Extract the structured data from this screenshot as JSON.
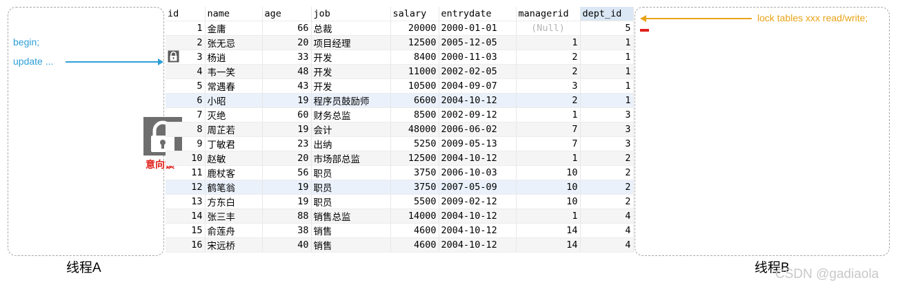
{
  "thread_a": {
    "label": "线程A",
    "begin": "begin;",
    "update": "update ..."
  },
  "thread_b": {
    "label": "线程B",
    "lock_statement": "lock tables xxx read/write;"
  },
  "intention_lock_label": "意向锁",
  "watermark": "CSDN @gadiaola",
  "icons": [
    "lock-icon",
    "row-lock-icon"
  ],
  "colors": {
    "blue_note": "#2e9fd8",
    "orange_note": "#e8a317",
    "red_label": "#e0201b"
  },
  "table": {
    "columns": [
      "id",
      "name",
      "age",
      "job",
      "salary",
      "entrydate",
      "managerid",
      "dept_id"
    ],
    "rows": [
      [
        "1",
        "金庸",
        "66",
        "总裁",
        "20000",
        "2000-01-01",
        "(Null)",
        "5"
      ],
      [
        "2",
        "张无忌",
        "20",
        "项目经理",
        "12500",
        "2005-12-05",
        "1",
        "1"
      ],
      [
        "3",
        "杨逍",
        "33",
        "开发",
        "8400",
        "2000-11-03",
        "2",
        "1"
      ],
      [
        "4",
        "韦一笑",
        "48",
        "开发",
        "11000",
        "2002-02-05",
        "2",
        "1"
      ],
      [
        "5",
        "常遇春",
        "43",
        "开发",
        "10500",
        "2004-09-07",
        "3",
        "1"
      ],
      [
        "6",
        "小昭",
        "19",
        "程序员鼓励师",
        "6600",
        "2004-10-12",
        "2",
        "1"
      ],
      [
        "7",
        "灭绝",
        "60",
        "财务总监",
        "8500",
        "2002-09-12",
        "1",
        "3"
      ],
      [
        "8",
        "周芷若",
        "19",
        "会计",
        "48000",
        "2006-06-02",
        "7",
        "3"
      ],
      [
        "9",
        "丁敏君",
        "23",
        "出纳",
        "5250",
        "2009-05-13",
        "7",
        "3"
      ],
      [
        "10",
        "赵敏",
        "20",
        "市场部总监",
        "12500",
        "2004-10-12",
        "1",
        "2"
      ],
      [
        "11",
        "鹿杖客",
        "56",
        "职员",
        "3750",
        "2006-10-03",
        "10",
        "2"
      ],
      [
        "12",
        "鹤笔翁",
        "19",
        "职员",
        "3750",
        "2007-05-09",
        "10",
        "2"
      ],
      [
        "13",
        "方东白",
        "19",
        "职员",
        "5500",
        "2009-02-12",
        "10",
        "2"
      ],
      [
        "14",
        "张三丰",
        "88",
        "销售总监",
        "14000",
        "2004-10-12",
        "1",
        "4"
      ],
      [
        "15",
        "俞莲舟",
        "38",
        "销售",
        "4600",
        "2004-10-12",
        "14",
        "4"
      ],
      [
        "16",
        "宋远桥",
        "40",
        "销售",
        "4600",
        "2004-10-12",
        "14",
        "4"
      ]
    ]
  }
}
